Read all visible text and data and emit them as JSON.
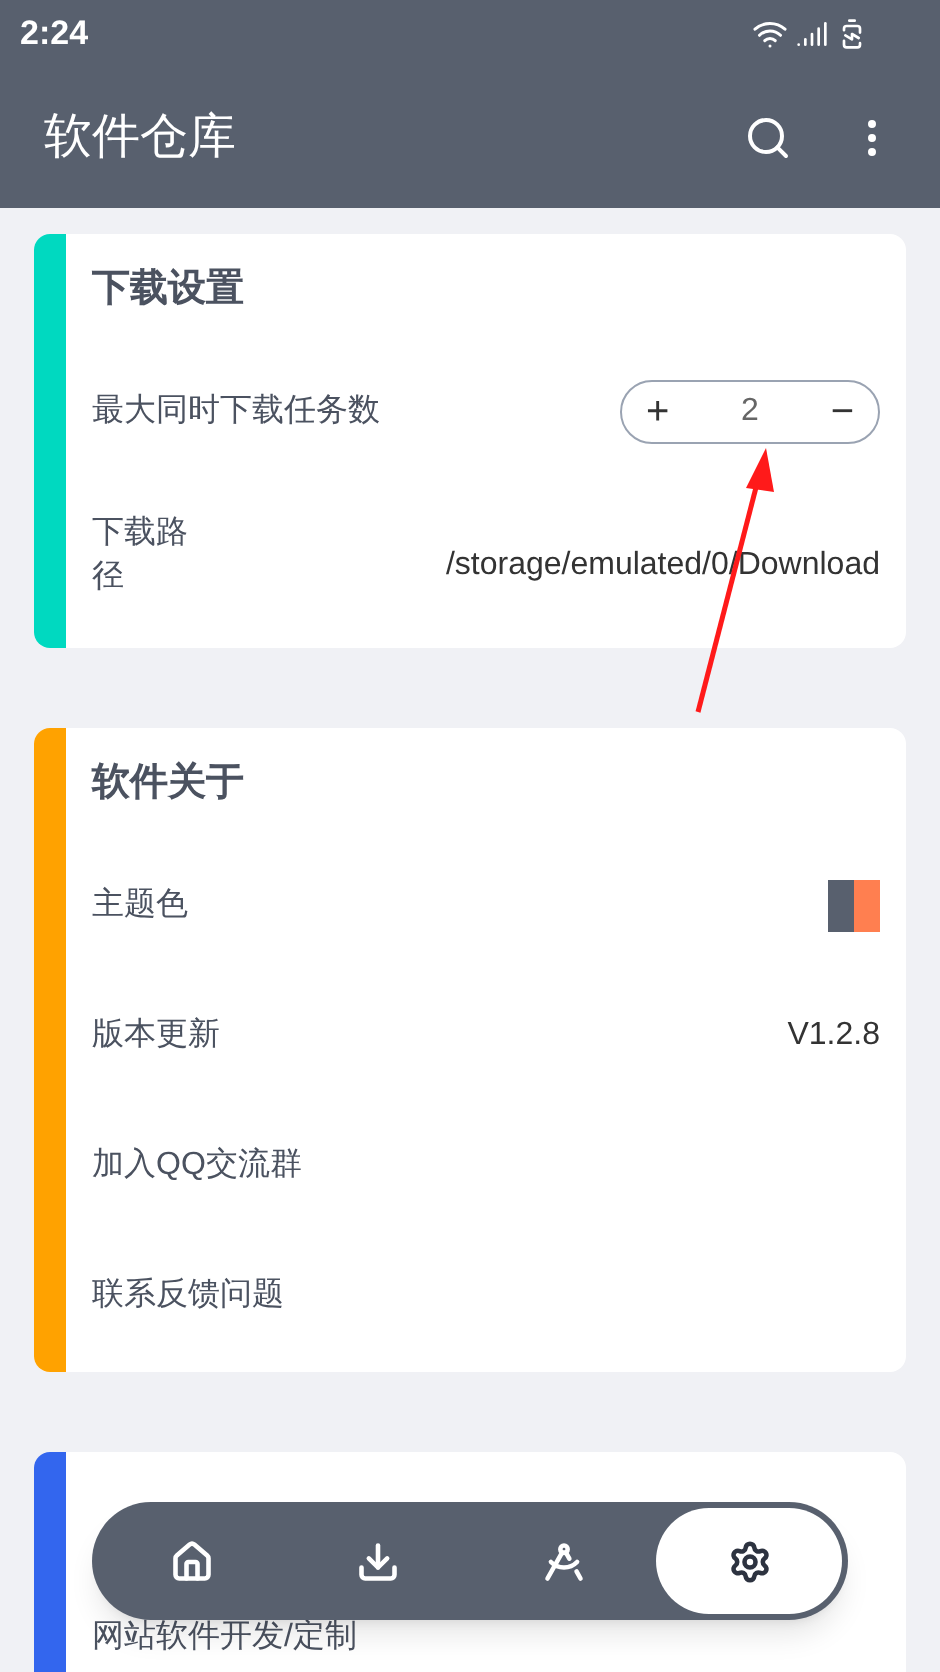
{
  "status_bar": {
    "time": "2:24"
  },
  "app_bar": {
    "title": "软件仓库"
  },
  "sections": [
    {
      "title": "下载设置",
      "color": "#00d9c0",
      "rows": [
        {
          "kind": "stepper",
          "label": "最大同时下载任务数",
          "plus": "+",
          "value": "2",
          "minus": "−"
        },
        {
          "kind": "value",
          "label": "下载路径",
          "value": "/storage/emulated/0/Download"
        }
      ]
    },
    {
      "title": "软件关于",
      "color": "#ffa200",
      "rows": [
        {
          "kind": "swatch",
          "label": "主题色",
          "colors": [
            {
              "color": "#58606e"
            },
            {
              "color": "#ff7f50"
            }
          ]
        },
        {
          "kind": "value",
          "label": "版本更新",
          "value": "V1.2.8"
        },
        {
          "kind": "plain",
          "label": "加入QQ交流群"
        },
        {
          "kind": "plain",
          "label": "联系反馈问题"
        }
      ]
    },
    {
      "color": "#3366ee",
      "rows": [
        {
          "kind": "plain",
          "label": "网站软件开发/定制"
        }
      ]
    }
  ],
  "bottom_nav": [
    {
      "selected": false
    },
    {
      "selected": false
    },
    {
      "selected": false
    },
    {
      "selected": true
    }
  ]
}
